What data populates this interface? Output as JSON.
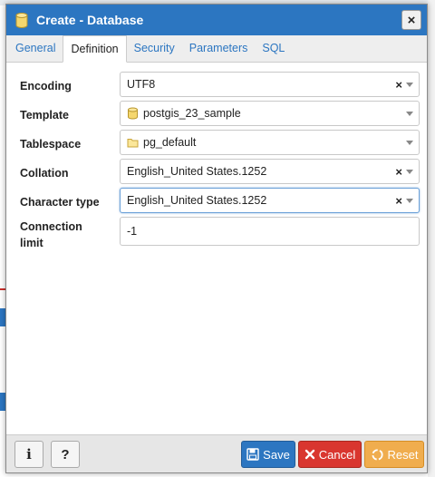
{
  "dialog": {
    "title": "Create - Database",
    "close_label": "×"
  },
  "tabs": [
    {
      "label": "General",
      "active": false
    },
    {
      "label": "Definition",
      "active": true
    },
    {
      "label": "Security",
      "active": false
    },
    {
      "label": "Parameters",
      "active": false
    },
    {
      "label": "SQL",
      "active": false
    }
  ],
  "form": {
    "encoding": {
      "label": "Encoding",
      "value": "UTF8",
      "clearable": true
    },
    "template": {
      "label": "Template",
      "value": "postgis_23_sample",
      "icon": "database-icon"
    },
    "tablespace": {
      "label": "Tablespace",
      "value": "pg_default",
      "icon": "folder-icon"
    },
    "collation": {
      "label": "Collation",
      "value": "English_United States.1252",
      "clearable": true
    },
    "character_type": {
      "label": "Character type",
      "value": "English_United States.1252",
      "clearable": true
    },
    "connection_limit": {
      "label_line1": "Connection",
      "label_line2": "limit",
      "value": "-1"
    }
  },
  "footer": {
    "info_label": "i",
    "help_label": "?",
    "save_label": "Save",
    "cancel_label": "Cancel",
    "reset_label": "Reset"
  },
  "colors": {
    "primary": "#2c76c1",
    "danger": "#d9362f",
    "warning": "#f0ad4e"
  }
}
